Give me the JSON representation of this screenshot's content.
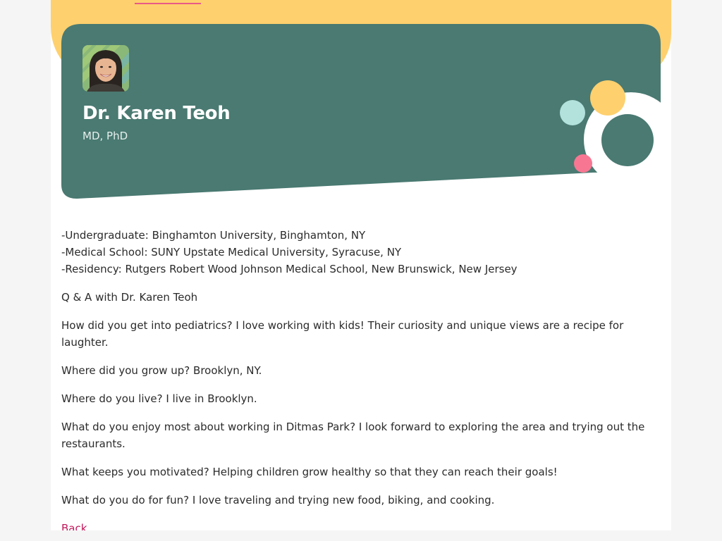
{
  "profile": {
    "name": "Dr. Karen Teoh",
    "credentials": "MD, PhD"
  },
  "education": [
    "-Undergraduate: Binghamton University, Binghamton, NY",
    "-Medical School: SUNY Upstate Medical University, Syracuse, NY",
    "-Residency: Rutgers Robert Wood Johnson Medical School, New Brunswick, New Jersey"
  ],
  "qa": {
    "heading": "Q & A with Dr. Karen Teoh",
    "items": [
      "How did you get into pediatrics? I love working with kids! Their curiosity and unique views are a recipe for laughter.",
      "Where did you grow up? Brooklyn, NY.",
      "Where do you live? I live in Brooklyn.",
      "What do you enjoy most about working in Ditmas Park? I look forward to exploring the area and trying out the restaurants.",
      "What keeps you motivated? Helping children grow healthy so that they can reach their goals!",
      "What do you do for fun? I love traveling and trying new food, biking, and cooking."
    ]
  },
  "back_label": "Back",
  "colors": {
    "hero_green": "#4a7a72",
    "brand_yellow": "#fed06e",
    "accent_pink": "#f77792",
    "mint": "#b3e1dc",
    "link": "#c2185b"
  }
}
